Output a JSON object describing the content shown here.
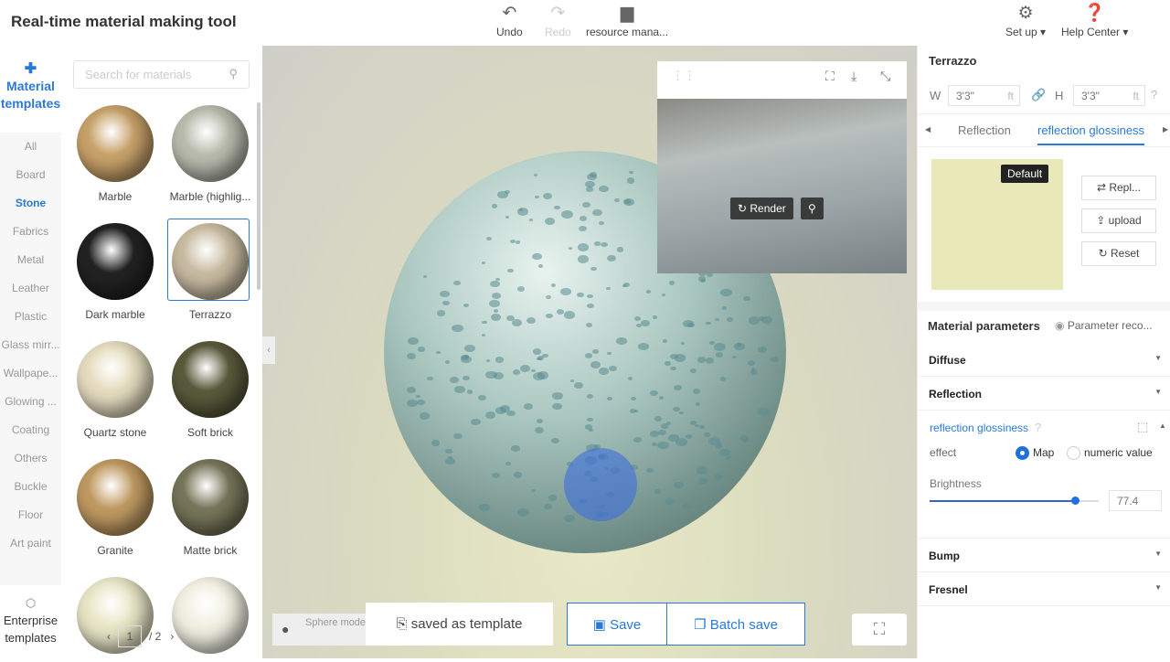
{
  "app": {
    "title": "Real-time material making tool"
  },
  "toolbar": {
    "undo": "Undo",
    "redo": "Redo",
    "resource": "resource mana...",
    "setup": "Set up",
    "help": "Help Center"
  },
  "nav": {
    "header": "Material templates",
    "categories": [
      "All",
      "Board",
      "Stone",
      "Fabrics",
      "Metal",
      "Leather",
      "Plastic",
      "Glass mirr...",
      "Wallpape...",
      "Glowing ...",
      "Coating",
      "Others",
      "Buckle",
      "Floor",
      "Art paint"
    ],
    "active": "Stone",
    "enterprise": "Enterprise templates"
  },
  "library": {
    "search_placeholder": "Search for materials",
    "items": [
      {
        "name": "Marble",
        "color": "#c8a26a"
      },
      {
        "name": "Marble (highlig...",
        "color": "#b9bcae"
      },
      {
        "name": "Dark marble",
        "color": "#222"
      },
      {
        "name": "Terrazzo",
        "color": "#c9bca2"
      },
      {
        "name": "Quartz stone",
        "color": "#e6ddc0"
      },
      {
        "name": "Soft brick",
        "color": "#5a5a3c"
      },
      {
        "name": "Granite",
        "color": "#c09a62"
      },
      {
        "name": "Matte brick",
        "color": "#77765a"
      },
      {
        "name": "",
        "color": "#e9e6c7"
      },
      {
        "name": "",
        "color": "#f1f0e2"
      }
    ],
    "page": "1",
    "total_pages": "/ 2"
  },
  "viewport": {
    "render": "Render",
    "model": "Sphere model",
    "save_template": "saved as template",
    "save": "Save",
    "batch_save": "Batch save"
  },
  "right": {
    "material_name": "Terrazzo",
    "w_label": "W",
    "w_value": "3'3\"",
    "h_label": "H",
    "h_value": "3'3\"",
    "unit": "ft",
    "tabs": [
      "Reflection",
      "reflection glossiness"
    ],
    "active_tab": "reflection glossiness",
    "default_badge": "Default",
    "replace": "Repl...",
    "upload": "upload",
    "reset": "Reset",
    "params_title": "Material parameters",
    "param_record": "Parameter reco...",
    "sections": [
      "Diffuse",
      "Reflection",
      "Bump",
      "Fresnel"
    ],
    "gloss": {
      "title": "reflection glossiness",
      "effect": "effect",
      "map": "Map",
      "numeric": "numeric value",
      "brightness": "Brightness",
      "value": "77.4",
      "fraction": 0.86
    }
  },
  "colors": {
    "accent": "#2a7ad5"
  }
}
